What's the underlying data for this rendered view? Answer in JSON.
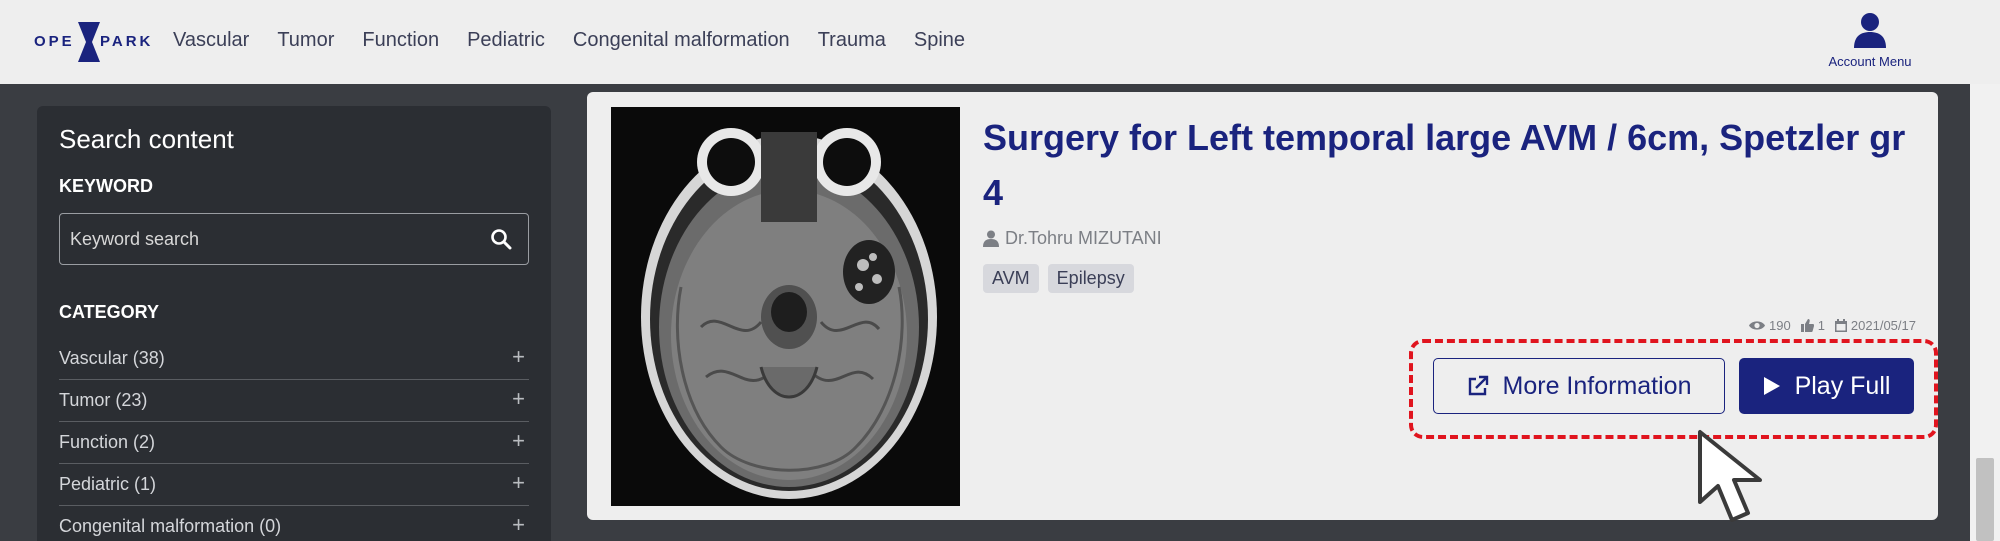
{
  "logo": {
    "left": "OPE",
    "right": "PARK"
  },
  "nav": [
    "Vascular",
    "Tumor",
    "Function",
    "Pediatric",
    "Congenital malformation",
    "Trauma",
    "Spine"
  ],
  "account": {
    "label": "Account Menu"
  },
  "sidebar": {
    "title": "Search content",
    "keyword_label": "KEYWORD",
    "keyword_placeholder": "Keyword search",
    "category_label": "CATEGORY",
    "categories": [
      {
        "label": "Vascular (38)"
      },
      {
        "label": "Tumor (23)"
      },
      {
        "label": "Function (2)"
      },
      {
        "label": "Pediatric (1)"
      },
      {
        "label": "Congenital malformation (0)"
      }
    ],
    "expand_symbol": "+"
  },
  "video": {
    "title": "Surgery for Left temporal large AVM / 6cm, Spetzler gr 4",
    "author": "Dr.Tohru MIZUTANI",
    "tags": [
      "AVM",
      "Epilepsy"
    ],
    "views": "190",
    "likes": "1",
    "date": "2021/05/17",
    "more_label": "More Information",
    "play_label": "Play Full"
  },
  "colors": {
    "brand": "#1a237e",
    "highlight": "#e0141e",
    "sidebar_bg": "#2b2e33",
    "page_bg": "#3a3d42"
  }
}
